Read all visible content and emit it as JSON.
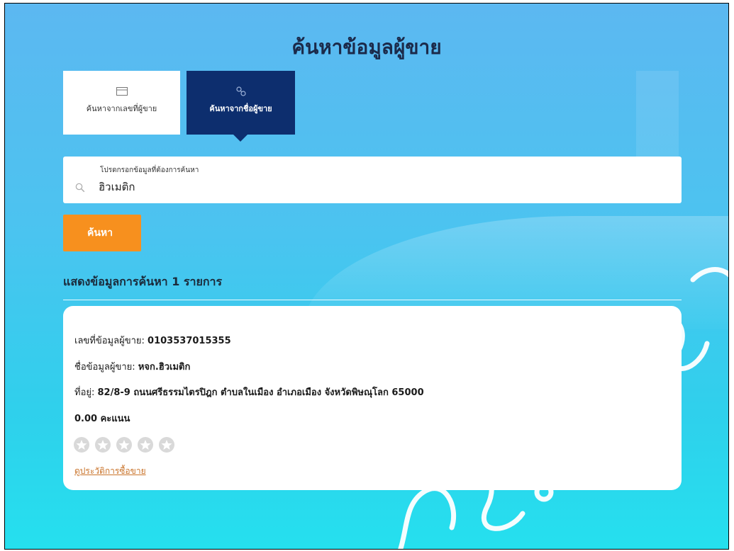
{
  "page": {
    "title": "ค้นหาข้อมูลผู้ขาย"
  },
  "tabs": [
    {
      "label": "ค้นหาจากเลขที่ผู้ขาย",
      "icon": "card-icon",
      "active": false
    },
    {
      "label": "ค้นหาจากชื่อผู้ขาย",
      "icon": "link-icon",
      "active": true
    }
  ],
  "search": {
    "label": "โปรดกรอกข้อมูลที่ต้องการค้นหา",
    "value": "ฮิวเมติก",
    "button_label": "ค้นหา"
  },
  "results": {
    "summary": "แสดงข้อมูลการค้นหา 1 รายการ",
    "items": [
      {
        "seller_id_label": "เลขที่ข้อมูลผู้ขาย:",
        "seller_id": "0103537015355",
        "seller_name_label": "ชื่อข้อมูลผู้ขาย:",
        "seller_name": "หจก.ฮิวเมติก",
        "address_label": "ที่อยู่:",
        "address": "82/8-9 ถนนศรีธรรมไตรปิฎก ตำบลในเมือง อำเภอเมือง จังหวัดพิษณุโลก 65000",
        "score": "0.00 คะแนน",
        "rating": 0,
        "max_rating": 5,
        "history_link": "ดูประวัติการซื้อขาย"
      }
    ]
  },
  "colors": {
    "accent": "#f7901e",
    "tab_active": "#0d2e6e",
    "link": "#c9732a"
  }
}
